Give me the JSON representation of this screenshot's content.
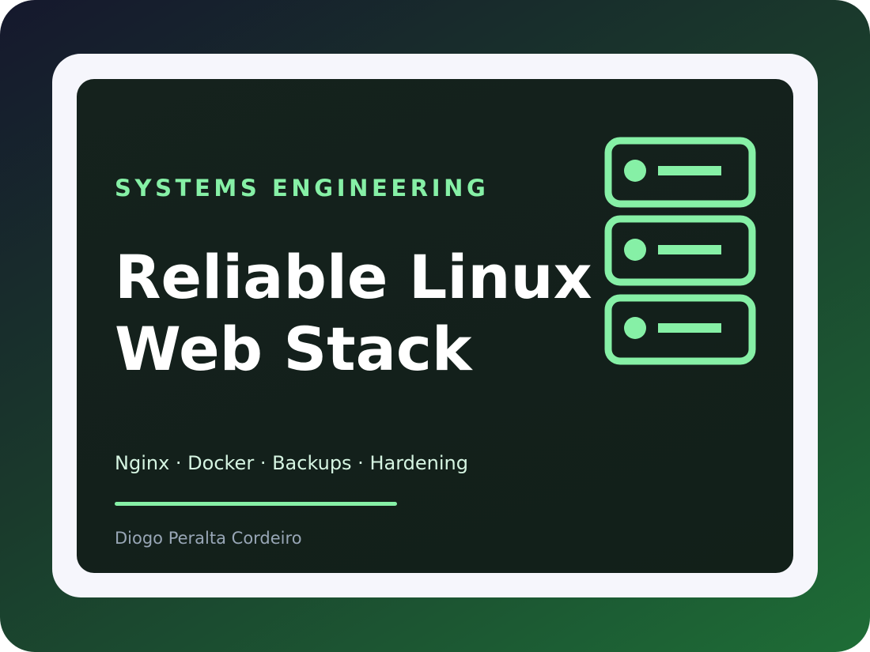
{
  "slide": {
    "eyebrow": "SYSTEMS ENGINEERING",
    "title_line1": "Reliable Linux",
    "title_line2": "Web Stack",
    "tags": "Nginx · Docker · Backups · Hardening",
    "author": "Diogo Peralta Cordeiro"
  },
  "colors": {
    "accent": "#86f0a6",
    "title": "#ffffff",
    "card_bg": "#13201b",
    "frame": "#f6f6fc"
  },
  "icons": {
    "server_stack": "server-stack-icon",
    "server_units": 3
  }
}
